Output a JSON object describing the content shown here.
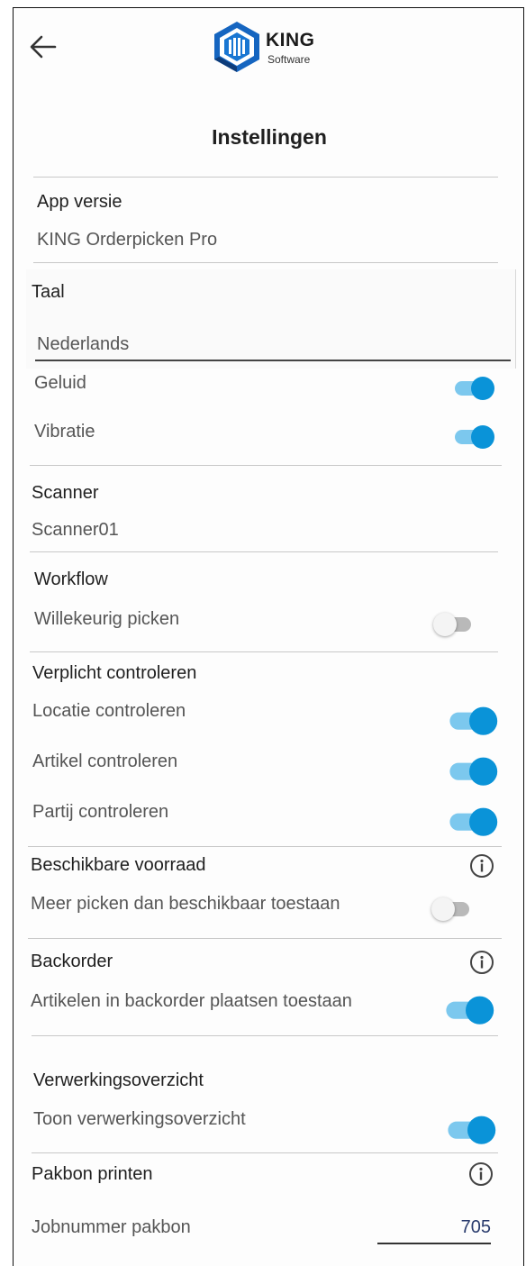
{
  "header": {
    "logo_title": "KING",
    "logo_subtitle": "Software",
    "page_title": "Instellingen"
  },
  "colors": {
    "accent": "#0a93d8",
    "accent_track": "#7cc8ee",
    "off_track": "#b9b9b9",
    "logo_blue": "#1565c0"
  },
  "app_version": {
    "label": "App versie",
    "value": "KING Orderpicken Pro"
  },
  "language": {
    "label": "Taal",
    "value": "Nederlands"
  },
  "sound": {
    "label": "Geluid",
    "enabled": true
  },
  "vibration": {
    "label": "Vibratie",
    "enabled": true
  },
  "scanner": {
    "label": "Scanner",
    "value": "Scanner01"
  },
  "workflow": {
    "label": "Workflow",
    "random_picking": {
      "label": "Willekeurig picken",
      "enabled": false
    }
  },
  "mandatory_check": {
    "label": "Verplicht controleren",
    "location": {
      "label": "Locatie controleren",
      "enabled": true
    },
    "article": {
      "label": "Artikel controleren",
      "enabled": true
    },
    "batch": {
      "label": "Partij controleren",
      "enabled": true
    }
  },
  "available_stock": {
    "label": "Beschikbare voorraad",
    "pick_more": {
      "label": "Meer picken dan beschikbaar toestaan",
      "enabled": false
    }
  },
  "backorder": {
    "label": "Backorder",
    "allow": {
      "label": "Artikelen in backorder plaatsen toestaan",
      "enabled": true
    }
  },
  "processing_overview": {
    "label": "Verwerkingsoverzicht",
    "show": {
      "label": "Toon verwerkingsoverzicht",
      "enabled": true
    }
  },
  "packing_slip": {
    "label": "Pakbon printen",
    "job_number": {
      "label": "Jobnummer pakbon",
      "value": "705"
    }
  }
}
